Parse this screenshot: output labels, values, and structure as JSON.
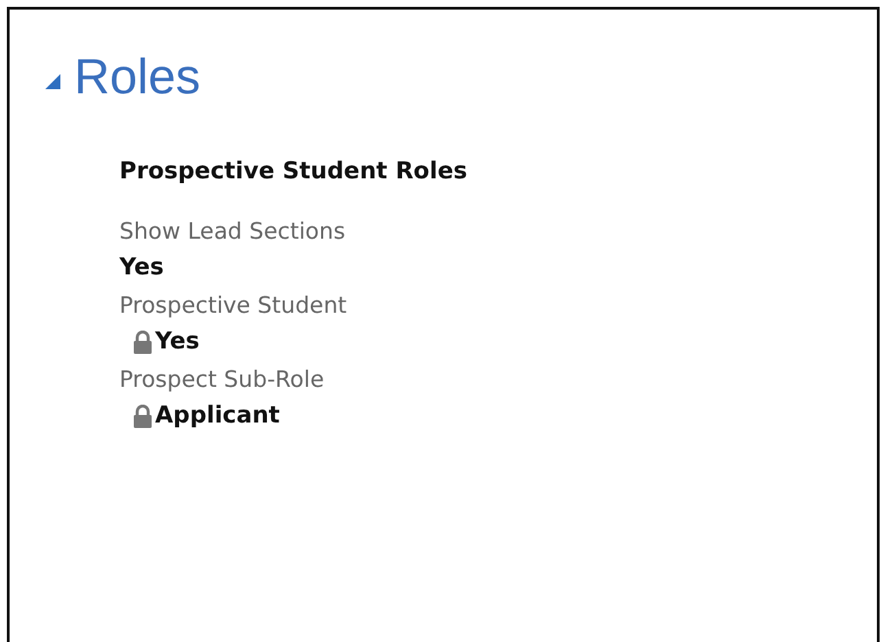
{
  "section": {
    "title": "Roles",
    "expanded": true
  },
  "group": {
    "title": "Prospective Student Roles"
  },
  "fields": [
    {
      "label": "Show Lead Sections",
      "value": "Yes",
      "locked": false
    },
    {
      "label": "Prospective Student",
      "value": "Yes",
      "locked": true
    },
    {
      "label": "Prospect Sub-Role",
      "value": "Applicant",
      "locked": true
    }
  ]
}
